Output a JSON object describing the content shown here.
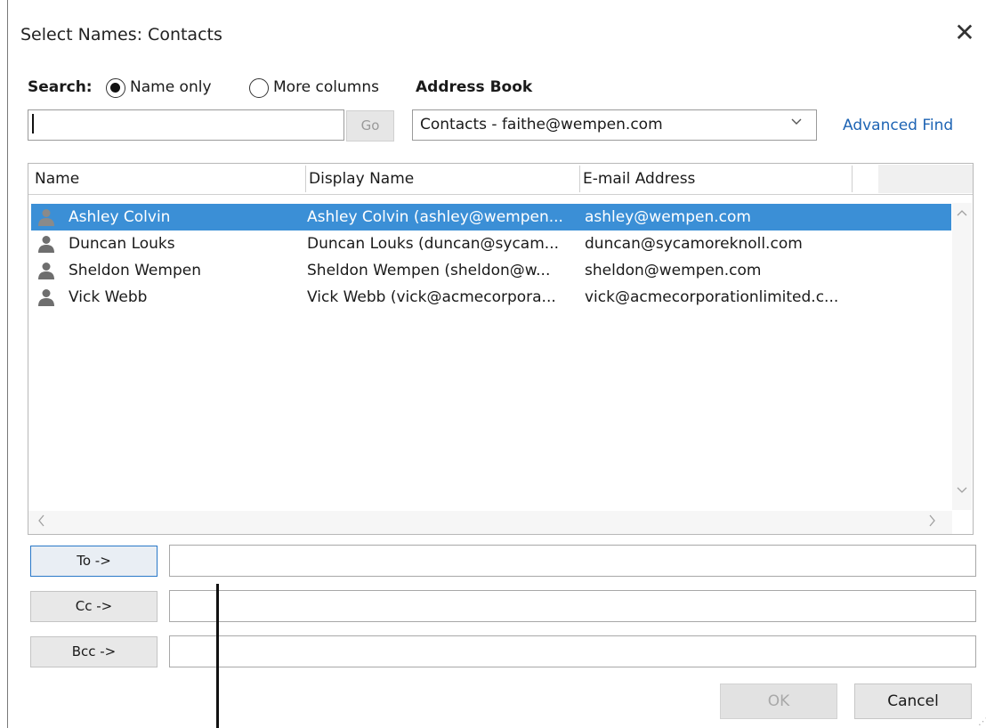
{
  "window": {
    "title": "Select Names: Contacts",
    "close_glyph": "✕"
  },
  "search": {
    "label": "Search:",
    "options": [
      {
        "label": "Name only",
        "selected": true
      },
      {
        "label": "More columns",
        "selected": false
      }
    ],
    "input_value": "",
    "go_label": "Go"
  },
  "address_book": {
    "label": "Address Book",
    "selected": "Contacts - faithe@wempen.com",
    "advanced_find": "Advanced Find"
  },
  "list": {
    "columns": [
      "Name",
      "Display Name",
      "E-mail Address"
    ],
    "rows": [
      {
        "name": "Ashley Colvin",
        "display": "Ashley Colvin (ashley@wempen...",
        "email": "ashley@wempen.com",
        "selected": true
      },
      {
        "name": "Duncan Louks",
        "display": "Duncan Louks (duncan@sycam...",
        "email": "duncan@sycamoreknoll.com",
        "selected": false
      },
      {
        "name": "Sheldon Wempen",
        "display": "Sheldon Wempen (sheldon@w...",
        "email": "sheldon@wempen.com",
        "selected": false
      },
      {
        "name": "Vick Webb",
        "display": "Vick Webb (vick@acmecorpora...",
        "email": "vick@acmecorporationlimited.c...",
        "selected": false
      }
    ],
    "row_icon": "person-icon"
  },
  "recipients": {
    "to_label": "To ->",
    "cc_label": "Cc ->",
    "bcc_label": "Bcc ->",
    "to_value": "",
    "cc_value": "",
    "bcc_value": ""
  },
  "footer": {
    "ok_label": "OK",
    "cancel_label": "Cancel"
  },
  "colors": {
    "selection": "#3b8fd6",
    "link": "#1e64b4",
    "focus_border": "#2a78c8"
  }
}
